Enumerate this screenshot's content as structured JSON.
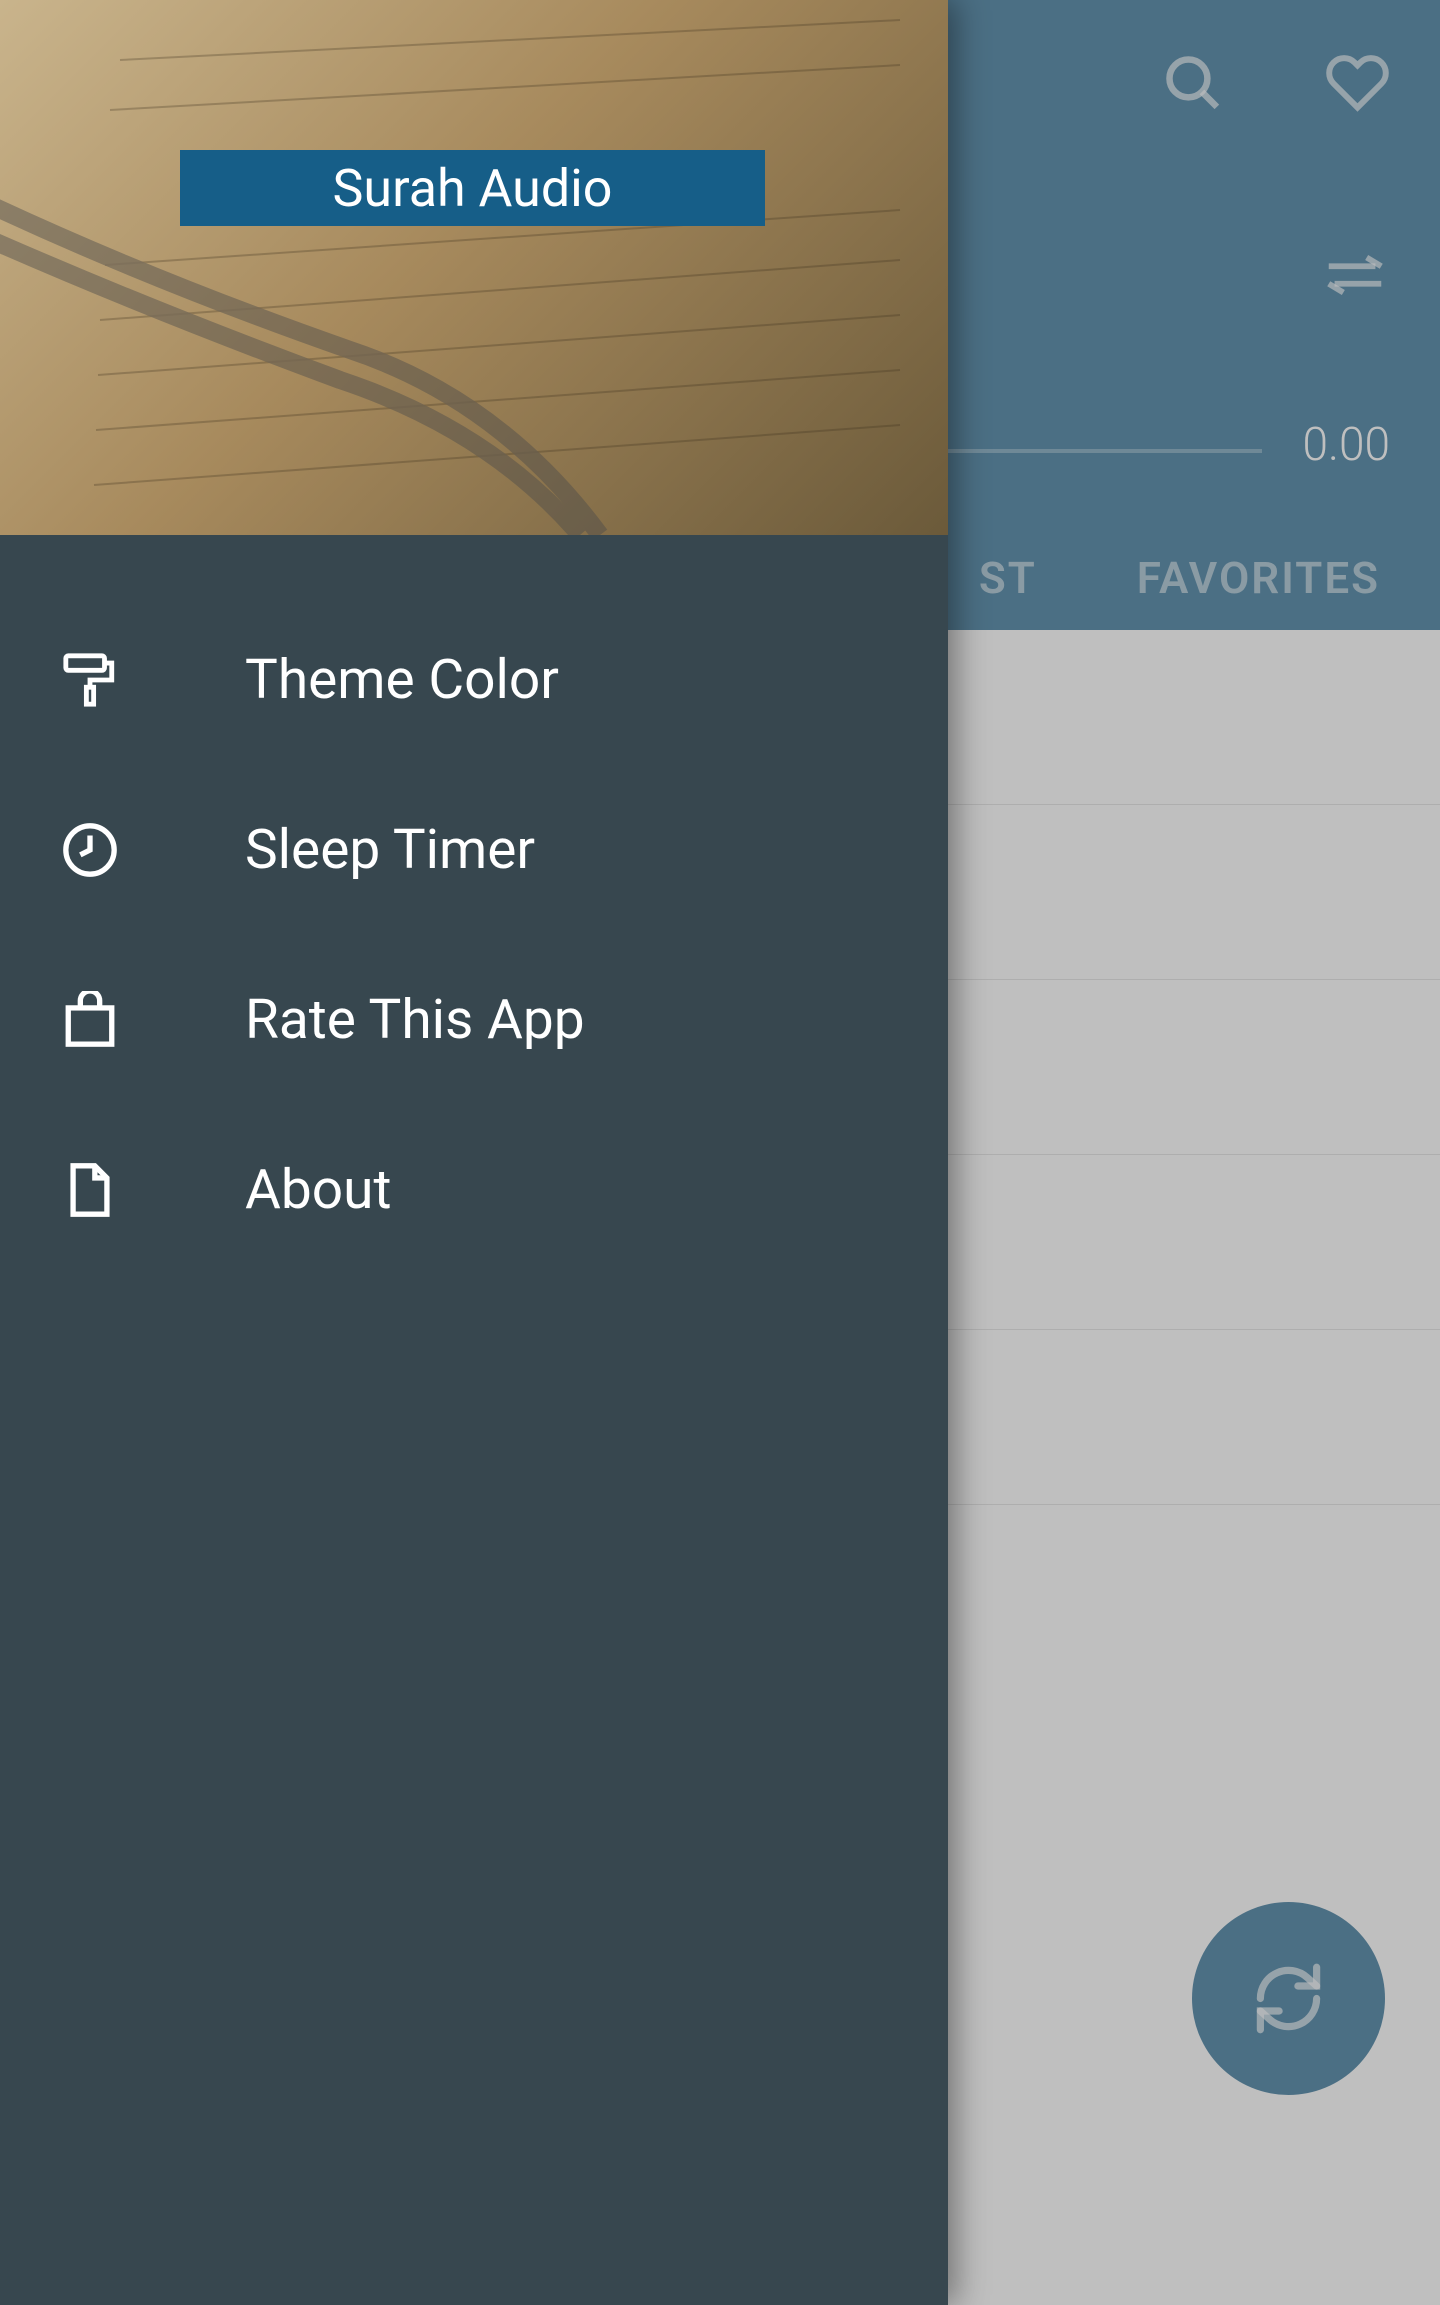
{
  "header": {
    "time_display": "0.00",
    "tab_list_partial": "ST",
    "tab_favorites": "FAVORITES"
  },
  "drawer": {
    "title": "Surah Audio",
    "items": [
      {
        "label": "Theme Color",
        "icon": "paint-roller-icon"
      },
      {
        "label": "Sleep Timer",
        "icon": "clock-icon"
      },
      {
        "label": "Rate This App",
        "icon": "shopping-bag-icon"
      },
      {
        "label": "About",
        "icon": "file-icon"
      }
    ]
  },
  "icons": {
    "search": "search-icon",
    "favorite": "heart-icon",
    "repeat": "repeat-icon",
    "fab": "sync-icon"
  }
}
